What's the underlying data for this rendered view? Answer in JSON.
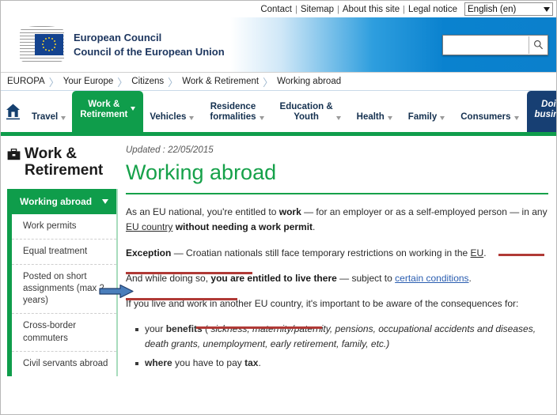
{
  "utility": {
    "links": [
      "Contact",
      "Sitemap",
      "About this site",
      "Legal notice"
    ],
    "separator": "|",
    "language": {
      "selected": "English (en)",
      "icon": "chevron-down-icon"
    }
  },
  "banner": {
    "logo": {
      "line1": "European Council",
      "line2": "Council of the European Union",
      "icon": "eu-flag-icon"
    },
    "search": {
      "value": "",
      "placeholder": "",
      "button_icon": "search-icon"
    },
    "gradient_start": "#ffffff",
    "gradient_end": "#0b80cc"
  },
  "breadcrumb": {
    "items": [
      "EUROPA",
      "Your Europe",
      "Citizens",
      "Work & Retirement",
      "Working abroad"
    ],
    "separator": "〉"
  },
  "mainnav": {
    "home_icon": "home-icon",
    "items": [
      {
        "label": "Travel",
        "caret": true,
        "state": "normal"
      },
      {
        "label_line1": "Work &",
        "label_line2": "Retirement",
        "caret": true,
        "state": "active"
      },
      {
        "label": "Vehicles",
        "caret": true,
        "state": "normal"
      },
      {
        "label_line1": "Residence",
        "label_line2": "formalities",
        "caret": true,
        "state": "normal"
      },
      {
        "label_line1": "Education &",
        "label_line2": "Youth",
        "caret": true,
        "state": "normal"
      },
      {
        "label": "Health",
        "caret": true,
        "state": "normal"
      },
      {
        "label": "Family",
        "caret": true,
        "state": "normal"
      },
      {
        "label": "Consumers",
        "caret": true,
        "state": "normal"
      },
      {
        "label_line1": "Doing",
        "label_line2": "business",
        "caret": true,
        "state": "dark"
      }
    ],
    "active_color": "#0f9d4b",
    "dark_color": "#173f73"
  },
  "sidebar": {
    "icon": "briefcase-icon",
    "title_line1": "Work &",
    "title_line2": "Retirement",
    "section": {
      "label": "Working abroad",
      "caret_icon": "chevron-down-icon"
    },
    "links": [
      "Work permits",
      "Equal treatment",
      "Posted on short assignments (max 2 years)",
      "Cross-border commuters",
      "Civil servants abroad"
    ]
  },
  "article": {
    "updated": "Updated : 22/05/2015",
    "title": "Working abroad",
    "p1": {
      "t1": "As an EU national, you're entitled to ",
      "b1": "work",
      "t2": " — for an employer or as a self-employed person — in any ",
      "u1": "EU country",
      "t3": " ",
      "b2": "without needing a work permit",
      "t4": "."
    },
    "p2": {
      "b1": "Exception",
      "t1": " — Croatian nationals still face temporary restrictions on working in the ",
      "u1": "EU",
      "t2": "."
    },
    "p3": {
      "t1": "And while doing so, ",
      "b1": "you are entitled to live there",
      "t2": " — subject to ",
      "link": "certain conditions",
      "t3": "."
    },
    "p4": "If you live and work in another EU country, it's important to be aware of the consequences for:",
    "bullets": [
      {
        "t1": "your ",
        "b1": "benefits",
        "t2": " ( ",
        "i1": "sickness, maternity/paternity, pensions, occupational accidents and diseases, death grants, unemployment, early retirement, family, etc.)",
        "t3": ""
      },
      {
        "b1": "where",
        "t1": " you have to pay ",
        "b2": "tax",
        "t2": "."
      }
    ]
  },
  "annotations": {
    "arrow": {
      "icon": "right-arrow-annotation",
      "color": "#4a7ebb",
      "points_to": "Exception"
    },
    "underline_color": "#b03a36"
  }
}
